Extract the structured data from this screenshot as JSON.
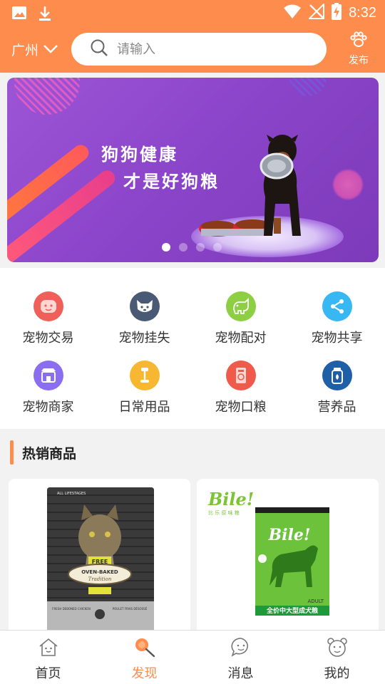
{
  "status_bar": {
    "time": "8:32",
    "left_icons": [
      "image-icon",
      "download-icon"
    ],
    "right_icons": [
      "wifi-icon",
      "no-signal-icon",
      "battery-charging-icon"
    ]
  },
  "header": {
    "city": "广州",
    "search_placeholder": "请输入",
    "publish_label": "发布",
    "background": "#fe8c4d"
  },
  "banner": {
    "line1": "狗狗健康",
    "line2": "才是好狗粮",
    "page_count": 4,
    "active_index": 0
  },
  "categories": [
    {
      "label": "宠物交易",
      "icon": "pet-trade-icon",
      "color": "#f0605a"
    },
    {
      "label": "宠物挂失",
      "icon": "pet-lost-icon",
      "color": "#4a5a75"
    },
    {
      "label": "宠物配对",
      "icon": "pet-match-icon",
      "color": "#8ccf43"
    },
    {
      "label": "宠物共享",
      "icon": "share-icon",
      "color": "#38b8f2"
    },
    {
      "label": "宠物商家",
      "icon": "shop-icon",
      "color": "#8b6ef0"
    },
    {
      "label": "日常用品",
      "icon": "daily-goods-icon",
      "color": "#f7b731"
    },
    {
      "label": "宠物口粮",
      "icon": "pet-food-icon",
      "color": "#f05a4a"
    },
    {
      "label": "营养品",
      "icon": "nutrition-icon",
      "color": "#1f5fa8"
    }
  ],
  "hot": {
    "title": "热销商品",
    "products": [
      {
        "package_top_text": "ALL LIFESTAGES",
        "package_badge": "FREE",
        "package_banner": "OVEN-BAKED",
        "package_sub": "Tradition",
        "package_flavor": "FRESH DEBONED CHICKEN",
        "package_flavor_fr": "POULET FRAIS DÉSOSSÉ"
      },
      {
        "brand": "Bile!",
        "brand_sub": "比 乐 原 味 粮",
        "package_brand": "Bile!",
        "package_label": "ADULT",
        "package_text": "全价中大型成犬粮"
      }
    ]
  },
  "bottom_nav": [
    {
      "label": "首页",
      "icon": "home-icon",
      "active": false
    },
    {
      "label": "发现",
      "icon": "discover-icon",
      "active": true
    },
    {
      "label": "消息",
      "icon": "message-icon",
      "active": false
    },
    {
      "label": "我的",
      "icon": "profile-icon",
      "active": false
    }
  ]
}
